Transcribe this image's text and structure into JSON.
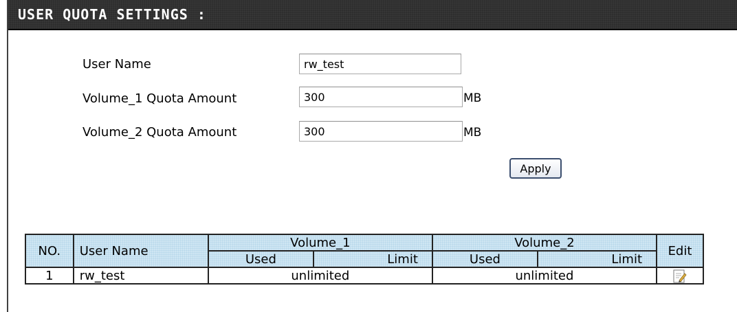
{
  "header": {
    "title": "USER QUOTA SETTINGS :"
  },
  "form": {
    "user_name_label": "User Name",
    "user_name_value": "rw_test",
    "volume1_label": "Volume_1 Quota Amount",
    "volume1_value": "300",
    "volume1_unit": "MB",
    "volume2_label": "Volume_2 Quota Amount",
    "volume2_value": "300",
    "volume2_unit": "MB",
    "apply_label": "Apply"
  },
  "table": {
    "headers": {
      "no": "NO.",
      "user_name": "User Name",
      "volume1": "Volume_1",
      "volume2": "Volume_2",
      "used": "Used",
      "limit": "Limit",
      "edit": "Edit"
    },
    "rows": [
      {
        "no": "1",
        "user_name": "rw_test",
        "volume1": "unlimited",
        "volume2": "unlimited",
        "edit_icon": "edit-icon"
      }
    ]
  },
  "colors": {
    "header_bg": "#2e2e2e",
    "table_header_bg": "#cfe6f3",
    "button_border": "#3b4e6e"
  }
}
